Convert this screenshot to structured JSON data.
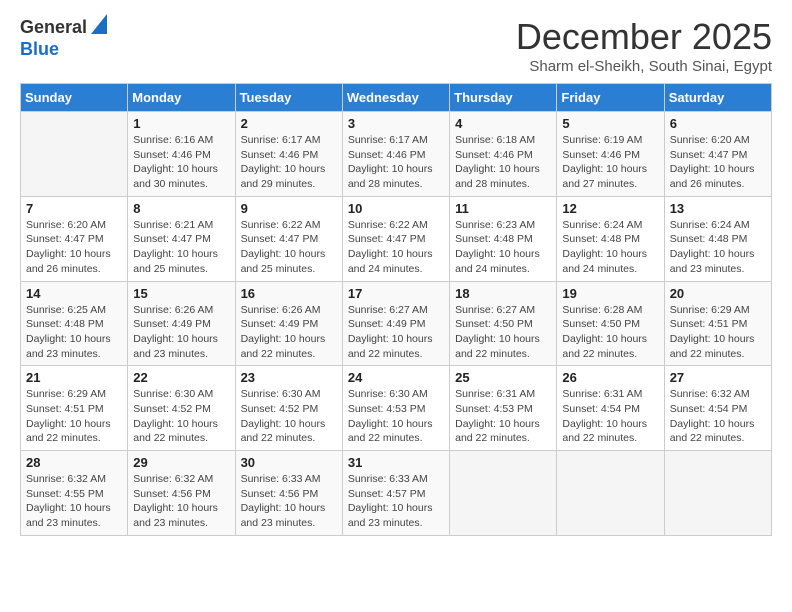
{
  "header": {
    "logo_line1": "General",
    "logo_line2": "Blue",
    "month_title": "December 2025",
    "location": "Sharm el-Sheikh, South Sinai, Egypt"
  },
  "days_of_week": [
    "Sunday",
    "Monday",
    "Tuesday",
    "Wednesday",
    "Thursday",
    "Friday",
    "Saturday"
  ],
  "weeks": [
    [
      {
        "day": "",
        "sunrise": "",
        "sunset": "",
        "daylight": ""
      },
      {
        "day": "1",
        "sunrise": "6:16 AM",
        "sunset": "4:46 PM",
        "daylight": "10 hours and 30 minutes."
      },
      {
        "day": "2",
        "sunrise": "6:17 AM",
        "sunset": "4:46 PM",
        "daylight": "10 hours and 29 minutes."
      },
      {
        "day": "3",
        "sunrise": "6:17 AM",
        "sunset": "4:46 PM",
        "daylight": "10 hours and 28 minutes."
      },
      {
        "day": "4",
        "sunrise": "6:18 AM",
        "sunset": "4:46 PM",
        "daylight": "10 hours and 28 minutes."
      },
      {
        "day": "5",
        "sunrise": "6:19 AM",
        "sunset": "4:46 PM",
        "daylight": "10 hours and 27 minutes."
      },
      {
        "day": "6",
        "sunrise": "6:20 AM",
        "sunset": "4:47 PM",
        "daylight": "10 hours and 26 minutes."
      }
    ],
    [
      {
        "day": "7",
        "sunrise": "6:20 AM",
        "sunset": "4:47 PM",
        "daylight": "10 hours and 26 minutes."
      },
      {
        "day": "8",
        "sunrise": "6:21 AM",
        "sunset": "4:47 PM",
        "daylight": "10 hours and 25 minutes."
      },
      {
        "day": "9",
        "sunrise": "6:22 AM",
        "sunset": "4:47 PM",
        "daylight": "10 hours and 25 minutes."
      },
      {
        "day": "10",
        "sunrise": "6:22 AM",
        "sunset": "4:47 PM",
        "daylight": "10 hours and 24 minutes."
      },
      {
        "day": "11",
        "sunrise": "6:23 AM",
        "sunset": "4:48 PM",
        "daylight": "10 hours and 24 minutes."
      },
      {
        "day": "12",
        "sunrise": "6:24 AM",
        "sunset": "4:48 PM",
        "daylight": "10 hours and 24 minutes."
      },
      {
        "day": "13",
        "sunrise": "6:24 AM",
        "sunset": "4:48 PM",
        "daylight": "10 hours and 23 minutes."
      }
    ],
    [
      {
        "day": "14",
        "sunrise": "6:25 AM",
        "sunset": "4:48 PM",
        "daylight": "10 hours and 23 minutes."
      },
      {
        "day": "15",
        "sunrise": "6:26 AM",
        "sunset": "4:49 PM",
        "daylight": "10 hours and 23 minutes."
      },
      {
        "day": "16",
        "sunrise": "6:26 AM",
        "sunset": "4:49 PM",
        "daylight": "10 hours and 22 minutes."
      },
      {
        "day": "17",
        "sunrise": "6:27 AM",
        "sunset": "4:49 PM",
        "daylight": "10 hours and 22 minutes."
      },
      {
        "day": "18",
        "sunrise": "6:27 AM",
        "sunset": "4:50 PM",
        "daylight": "10 hours and 22 minutes."
      },
      {
        "day": "19",
        "sunrise": "6:28 AM",
        "sunset": "4:50 PM",
        "daylight": "10 hours and 22 minutes."
      },
      {
        "day": "20",
        "sunrise": "6:29 AM",
        "sunset": "4:51 PM",
        "daylight": "10 hours and 22 minutes."
      }
    ],
    [
      {
        "day": "21",
        "sunrise": "6:29 AM",
        "sunset": "4:51 PM",
        "daylight": "10 hours and 22 minutes."
      },
      {
        "day": "22",
        "sunrise": "6:30 AM",
        "sunset": "4:52 PM",
        "daylight": "10 hours and 22 minutes."
      },
      {
        "day": "23",
        "sunrise": "6:30 AM",
        "sunset": "4:52 PM",
        "daylight": "10 hours and 22 minutes."
      },
      {
        "day": "24",
        "sunrise": "6:30 AM",
        "sunset": "4:53 PM",
        "daylight": "10 hours and 22 minutes."
      },
      {
        "day": "25",
        "sunrise": "6:31 AM",
        "sunset": "4:53 PM",
        "daylight": "10 hours and 22 minutes."
      },
      {
        "day": "26",
        "sunrise": "6:31 AM",
        "sunset": "4:54 PM",
        "daylight": "10 hours and 22 minutes."
      },
      {
        "day": "27",
        "sunrise": "6:32 AM",
        "sunset": "4:54 PM",
        "daylight": "10 hours and 22 minutes."
      }
    ],
    [
      {
        "day": "28",
        "sunrise": "6:32 AM",
        "sunset": "4:55 PM",
        "daylight": "10 hours and 23 minutes."
      },
      {
        "day": "29",
        "sunrise": "6:32 AM",
        "sunset": "4:56 PM",
        "daylight": "10 hours and 23 minutes."
      },
      {
        "day": "30",
        "sunrise": "6:33 AM",
        "sunset": "4:56 PM",
        "daylight": "10 hours and 23 minutes."
      },
      {
        "day": "31",
        "sunrise": "6:33 AM",
        "sunset": "4:57 PM",
        "daylight": "10 hours and 23 minutes."
      },
      {
        "day": "",
        "sunrise": "",
        "sunset": "",
        "daylight": ""
      },
      {
        "day": "",
        "sunrise": "",
        "sunset": "",
        "daylight": ""
      },
      {
        "day": "",
        "sunrise": "",
        "sunset": "",
        "daylight": ""
      }
    ]
  ]
}
